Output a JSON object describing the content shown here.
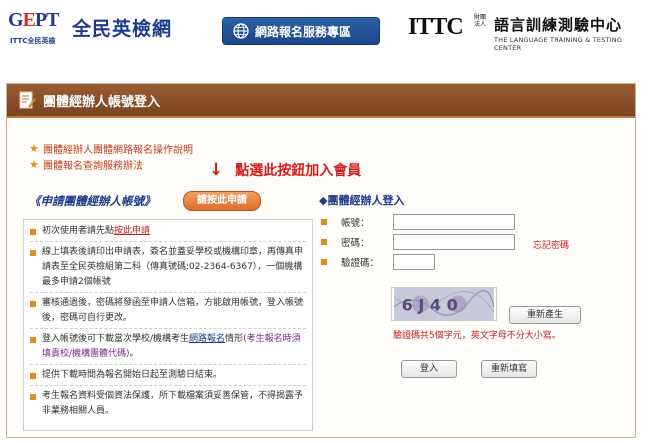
{
  "header": {
    "gept_mark_pre": "G",
    "gept_mark_o": "E",
    "gept_mark_post": "PT",
    "gept_sub": "ITTC全民英檢",
    "gept_name": "全民英檢網",
    "service_button": "網路報名服務專區",
    "ittc_mark": "ITTC",
    "ittc_reg": "財團\n法人",
    "ittc_name": "語言訓練測驗中心",
    "ittc_sub": "THE LANGUAGE TRAINING & TESTING CENTER"
  },
  "panel": {
    "title": "團體經辦人帳號登入",
    "links": [
      "團體經辦人團體網路報名操作說明",
      "團體報名查詢服務辦法"
    ],
    "annotation_arrow": "↓",
    "annotation": "點選此按鈕加入會員",
    "apply_title": "《申請團體經辦人帳號》",
    "apply_button": "請按此申請"
  },
  "info": {
    "item1_pre": "初次使用者請先點",
    "item1_link": "按此申請",
    "item2": "線上填表後請印出申請表，簽名並蓋妥學校或機構印章，再傳真申請表至全民英檢組第二科（傳真號碼:02-2364-6367），一個機構最多申請2個帳號",
    "item3": "審核通過後，密碼將發函至申請人信箱，方能啟用帳號，登入帳號後，密碼可自行更改。",
    "item4_pre": "登入帳號後可下載當次學校/機構考生",
    "item4_link": "網路報名",
    "item4_mid": "情形",
    "item4_note": "(考生報名時須填貴校/機構團體代碼)",
    "item4_end": "。",
    "item5": "提供下載時間為報名開始日起至測驗日結束。",
    "item6": "考生報名資料受個資法保護，所下載檔案須妥善保管，不得揭露予非業務相關人員。"
  },
  "login": {
    "title": "◆團體經辦人登入",
    "account_label": "帳號：",
    "password_label": "密碼：",
    "captcha_label": "驗證碼：",
    "forgot": "忘記密碼",
    "captcha_text": "6 J 4 0",
    "regen_button": "重新產生",
    "captcha_note": "驗證碼共5個字元，英文字母不分大小寫。",
    "login_button": "登入",
    "reset_button": "重新填寫"
  }
}
